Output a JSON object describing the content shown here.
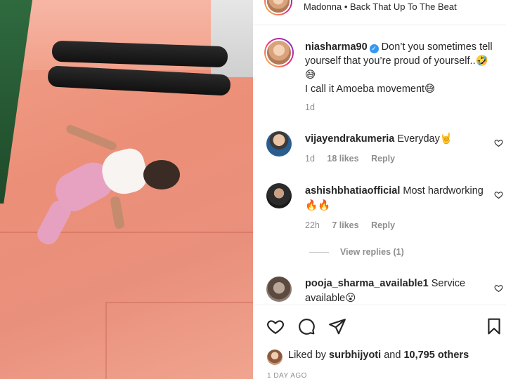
{
  "post": {
    "audio": "Madonna • Back That Up To The Beat",
    "caption": {
      "username": "niasharma90",
      "text": "Don’t you sometimes tell yourself that you’re proud of yourself..🤣😅",
      "line2": "I call it Amoeba movement😅",
      "time": "1d"
    },
    "comments": [
      {
        "username": "vijayendrakumeria",
        "text": "Everyday🤘",
        "time": "1d",
        "likes": "18 likes",
        "reply": "Reply"
      },
      {
        "username": "ashishbhatiaofficial",
        "text": "Most hardworking 🔥🔥",
        "time": "22h",
        "likes": "7 likes",
        "reply": "Reply",
        "view_replies": "View replies (1)"
      },
      {
        "username": "pooja_sharma_available1",
        "text": "Service available😮"
      }
    ],
    "likes": {
      "prefix": "Liked by",
      "user": "surbhijyoti",
      "and": "and",
      "others": "10,795 others"
    },
    "date": "1 DAY AGO"
  },
  "icons": {
    "like": "heart-icon",
    "comment": "comment-icon",
    "share": "share-icon",
    "save": "bookmark-icon",
    "verified": "verified-badge-icon"
  },
  "colors": {
    "verified": "#3897f0",
    "muted_text": "#8e8e8e",
    "text": "#262626"
  }
}
